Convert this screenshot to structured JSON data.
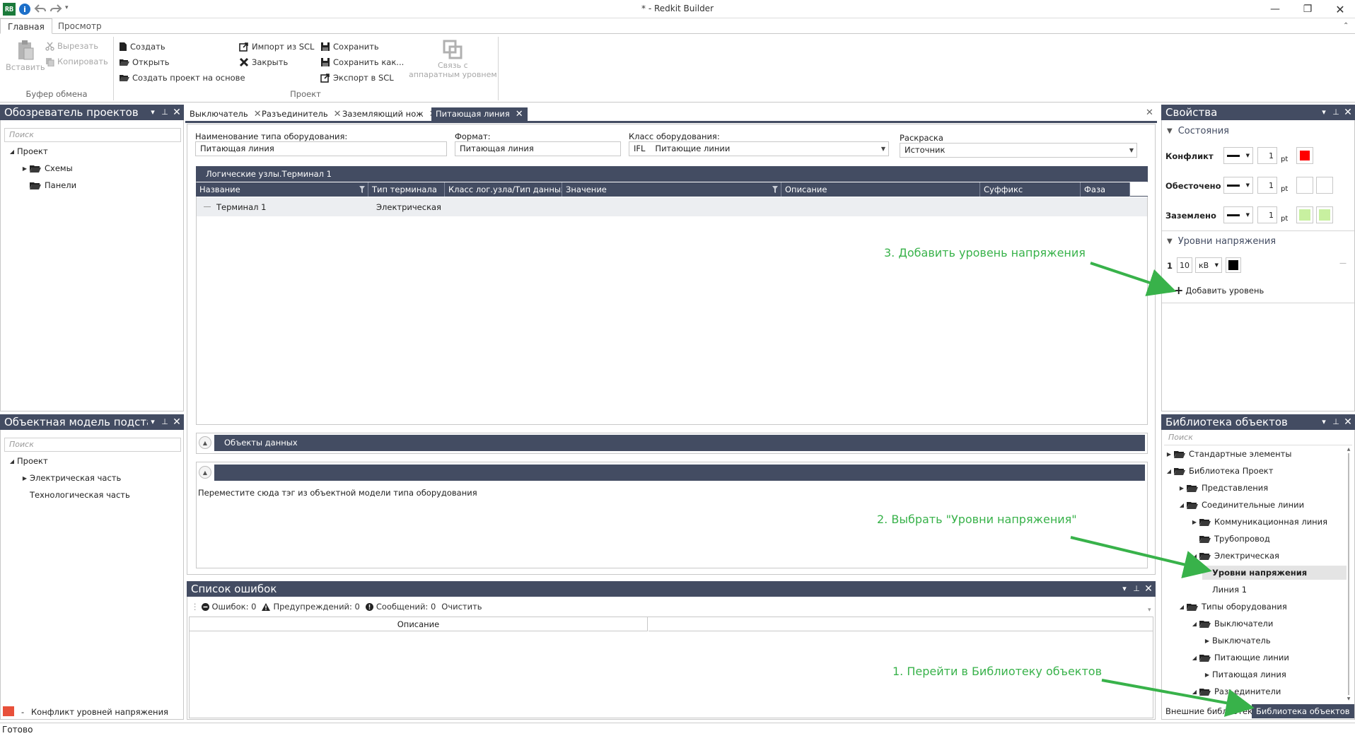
{
  "window": {
    "logo": "RB",
    "title": "* - Redkit Builder"
  },
  "ribbon": {
    "tabs": [
      "Главная",
      "Просмотр"
    ],
    "clipboard": {
      "paste": "Вставить",
      "cut": "Вырезать",
      "copy": "Копировать",
      "group_label": "Буфер обмена"
    },
    "project": {
      "create": "Создать",
      "open": "Открыть",
      "create_from": "Создать проект на основе",
      "import_scl": "Импорт из SCL",
      "close": "Закрыть",
      "save": "Сохранить",
      "save_as": "Сохранить как...",
      "export_scl": "Экспорт в SCL",
      "hw_link_1": "Связь с",
      "hw_link_2": "аппаратным уровнем",
      "group_label": "Проект"
    }
  },
  "project_explorer": {
    "title": "Обозреватель проектов",
    "search_placeholder": "Поиск",
    "tree": [
      "Проект",
      "Схемы",
      "Панели"
    ]
  },
  "substation_model": {
    "title": "Объектная модель подстанции",
    "search_placeholder": "Поиск",
    "tree": [
      "Проект",
      "Электрическая часть",
      "Технологическая часть"
    ]
  },
  "legend": {
    "dash": "-",
    "text": "Конфликт уровней напряжения",
    "color": "#e8503a"
  },
  "doc_tabs": [
    "Выключатель",
    "Разъединитель",
    "Заземляющий нож",
    "Питающая линия"
  ],
  "form": {
    "type_name_label": "Наименование типа оборудования:",
    "type_name_value": "Питающая линия",
    "format_label": "Формат:",
    "format_value": "Питающая линия",
    "class_label": "Класс оборудования:",
    "class_code": "IFL",
    "class_value": "Питающие линии",
    "coloring_label": "Раскраска",
    "coloring_value": "Источник"
  },
  "grid": {
    "title": "Логические узлы.Терминал 1",
    "columns": [
      "Название",
      "Тип терминала",
      "Класс лог.узла/Тип данных",
      "Значение",
      "Описание",
      "Суффикс",
      "Фаза"
    ],
    "rows": [
      {
        "name": "Терминал 1",
        "type": "Электрическая"
      }
    ]
  },
  "data_objects": {
    "title": "Объекты данных"
  },
  "drop_zone": {
    "hint": "Переместите сюда тэг из объектной модели типа оборудования"
  },
  "errors": {
    "title": "Список ошибок",
    "errors_label": "Ошибок: 0",
    "warnings_label": "Предупреждений: 0",
    "messages_label": "Сообщений: 0",
    "clear": "Очистить",
    "column": "Описание"
  },
  "properties": {
    "title": "Свойства",
    "states_title": "Состояния",
    "states": [
      {
        "label": "Конфликт",
        "width": "1",
        "unit": "pt",
        "color1": "#ff0000",
        "color2": ""
      },
      {
        "label": "Обесточено",
        "width": "1",
        "unit": "pt",
        "color1": "#ffffff",
        "color2": "#ffffff"
      },
      {
        "label": "Заземлено",
        "width": "1",
        "unit": "pt",
        "color1": "#c8f0a0",
        "color2": "#c8f0a0"
      }
    ],
    "voltage_title": "Уровни напряжения",
    "voltage_index": "1",
    "voltage_value": "10",
    "voltage_unit": "кВ",
    "voltage_color": "#000000",
    "voltage_dash": "—",
    "add_level": "Добавить уровень"
  },
  "library": {
    "title": "Библиотека объектов",
    "search_placeholder": "Поиск",
    "tree": [
      "Стандартные элементы",
      "Библиотека Проект",
      "Представления",
      "Соединительные линии",
      "Коммуникационная линия",
      "Трубопровод",
      "Электрическая",
      "Уровни напряжения",
      "Линия 1",
      "Типы оборудования",
      "Выключатели",
      "Выключатель",
      "Питающие линии",
      "Питающая линия",
      "Разъединители"
    ],
    "bottom_tabs": [
      "Внешние библиотеки",
      "Библиотека объектов"
    ]
  },
  "annotations": {
    "step1": "1. Перейти в Библиотеку объектов",
    "step2": "2. Выбрать \"Уровни напряжения\"",
    "step3": "3. Добавить уровень напряжения",
    "color": "#38b24a"
  },
  "status": {
    "text": "Готово"
  }
}
